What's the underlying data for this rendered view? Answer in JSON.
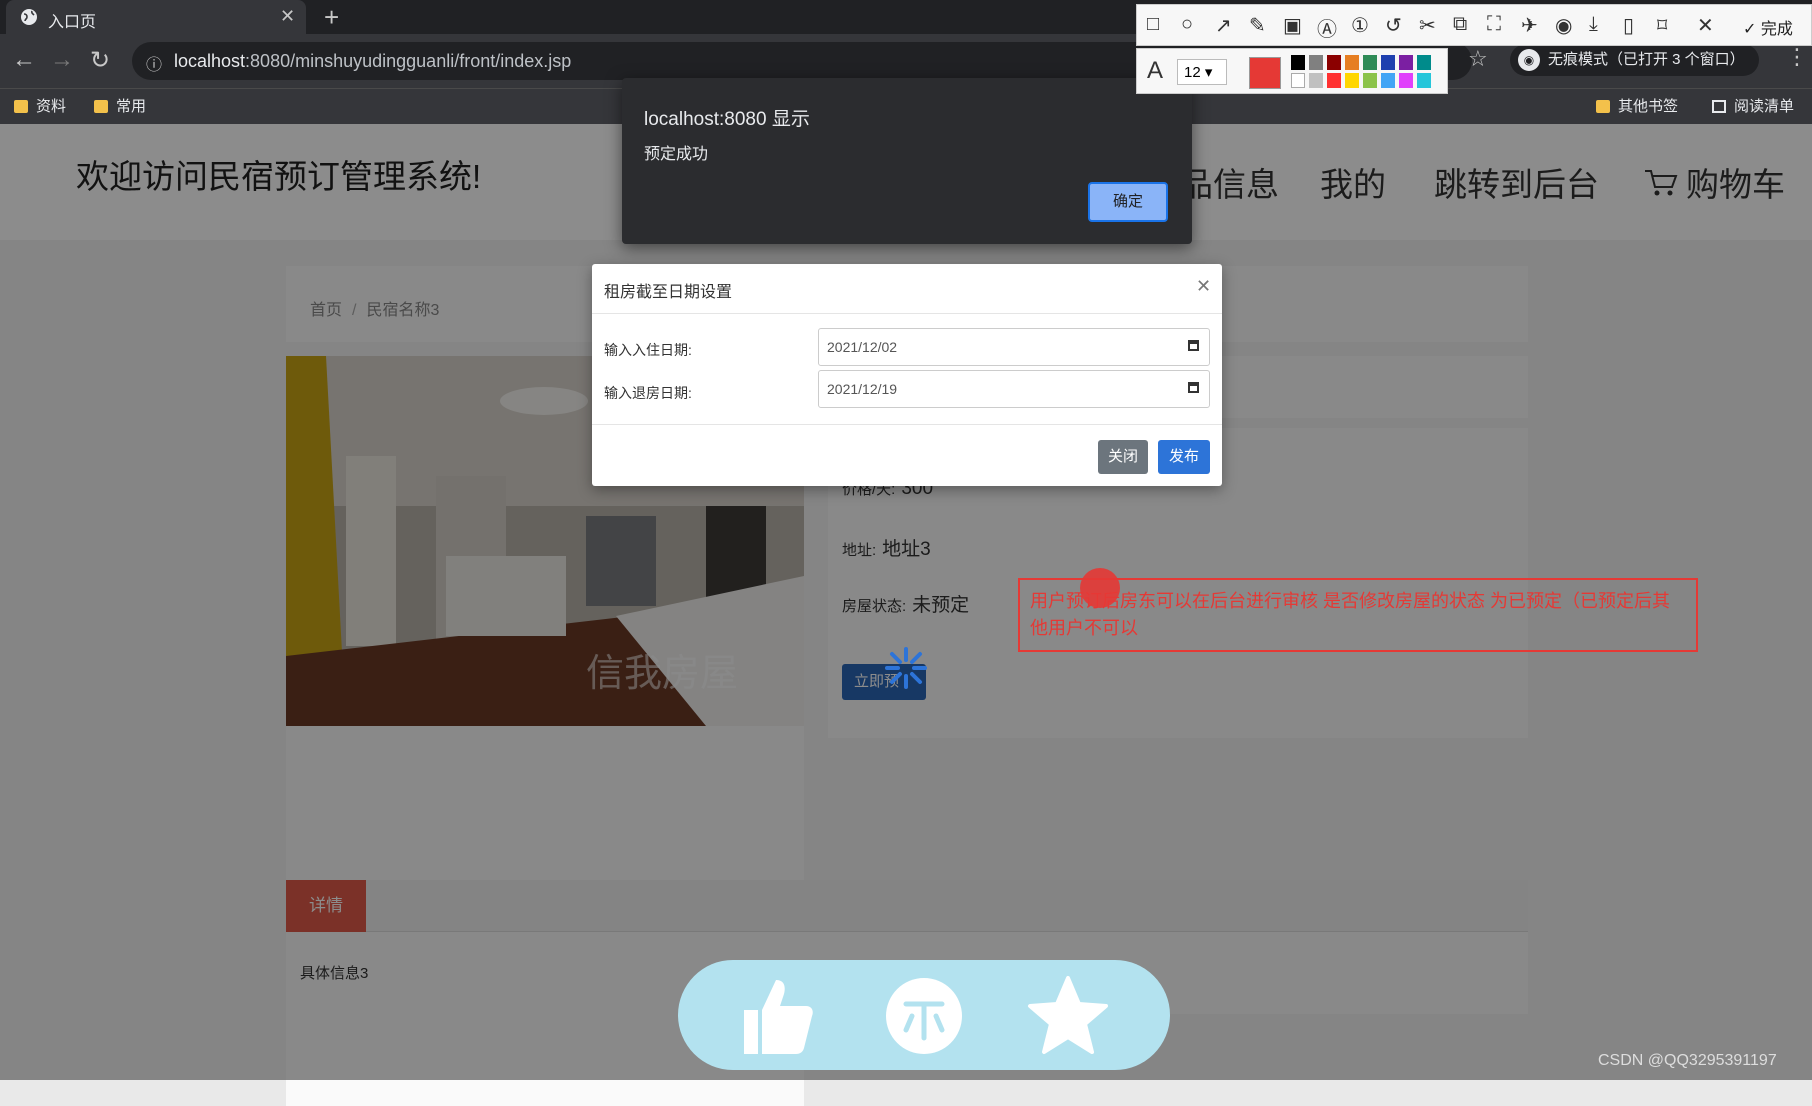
{
  "browser": {
    "tab_title": "入口页",
    "url_host": "localhost",
    "url_rest": ":8080/minshuyudingguanli/front/index.jsp",
    "incognito_label": "无痕模式（已打开 3 个窗口）",
    "bookmarks": [
      "资料",
      "常用"
    ],
    "other_bookmarks": "其他书签",
    "reading_list": "阅读清单"
  },
  "snip_toolbar": {
    "done_label": "完成",
    "font_size": "12",
    "current_color": "#e53935"
  },
  "site": {
    "title": "欢迎访问民宿预订管理系统!",
    "nav": [
      "品信息",
      "我的",
      "跳转到后台",
      "购物车"
    ]
  },
  "breadcrumb": {
    "home": "首页",
    "sep": "/",
    "current": "民宿名称3"
  },
  "room": {
    "price_label": "价格/天:",
    "price_value": "300",
    "address_label": "地址:",
    "address_value": "地址3",
    "status_label": "房屋状态:",
    "status_value": "未预定",
    "book_button": "立即预"
  },
  "photo_watermark": "信我房屋",
  "details": {
    "tab_label": "详情",
    "text": "具体信息3"
  },
  "modal": {
    "title": "租房截至日期设置",
    "checkin_label": "输入入住日期:",
    "checkin_value": "2021/12/02",
    "checkout_label": "输入退房日期:",
    "checkout_value": "2021/12/19",
    "close_label": "关闭",
    "publish_label": "发布"
  },
  "alert": {
    "title": "localhost:8080 显示",
    "message": "预定成功",
    "ok_label": "确定"
  },
  "annotation": {
    "text": "用户预订后房东可以在后台进行审核 是否修改房屋的状态 为已预定（已预定后其他用户不可以"
  },
  "credit": "CSDN @QQ3295391197"
}
